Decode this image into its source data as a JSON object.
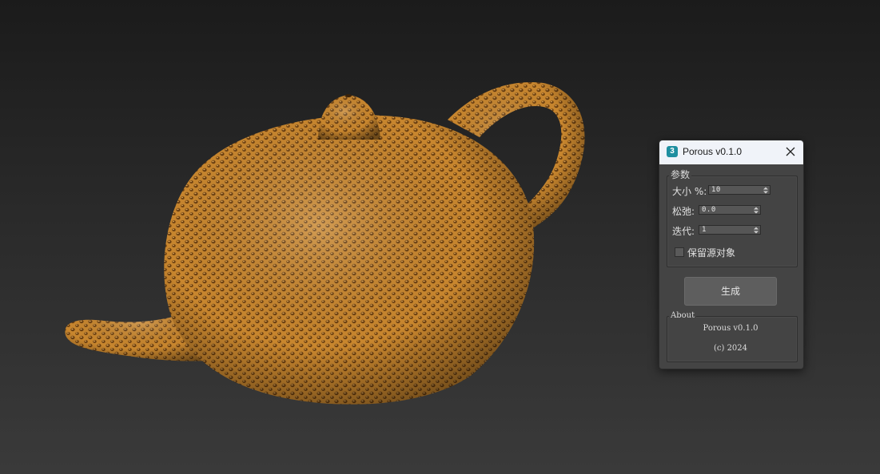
{
  "viewport": {
    "object": "porous-teapot",
    "object_color": "#c8862e"
  },
  "dialog": {
    "title": "Porous v0.1.0",
    "icon": "3ds-max-logo",
    "logo_text": "3",
    "close_icon": "close-icon",
    "params": {
      "group_label": "参数",
      "size_label": "大小 %:",
      "size_value": "10",
      "relax_label": "松弛:",
      "relax_value": "0.0",
      "iter_label": "迭代:",
      "iter_value": "1",
      "keep_source_label": "保留源对象",
      "keep_source_checked": false
    },
    "generate_label": "生成",
    "about": {
      "group_label": "About",
      "line1": "Porous v0.1.0",
      "line2": "(c) 2024"
    }
  }
}
